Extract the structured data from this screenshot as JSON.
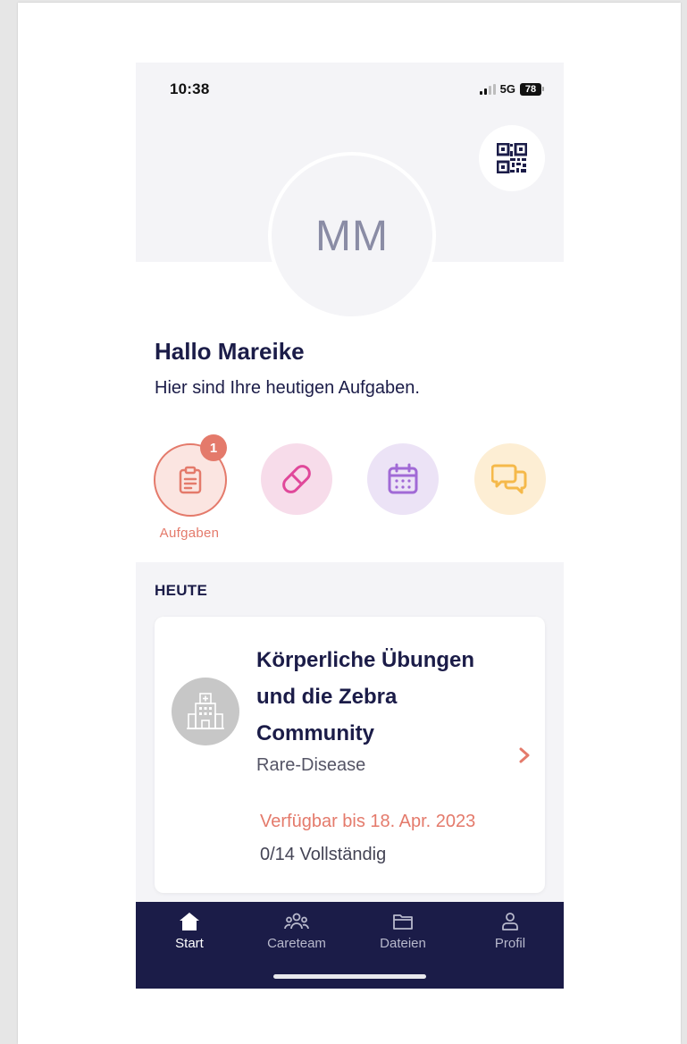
{
  "status_bar": {
    "time": "10:38",
    "network": "5G",
    "battery": "78"
  },
  "header": {
    "qr_icon": "qr-code-icon",
    "avatar_initials": "MM"
  },
  "greeting": {
    "title": "Hallo Mareike",
    "subtitle": "Hier sind Ihre heutigen Aufgaben."
  },
  "quick_actions": [
    {
      "icon": "clipboard-icon",
      "label": "Aufgaben",
      "badge": "1",
      "color": "#e47a6b"
    },
    {
      "icon": "pill-icon",
      "color": "#e0489a"
    },
    {
      "icon": "calendar-icon",
      "color": "#a16ad6"
    },
    {
      "icon": "chat-bubbles-icon",
      "color": "#f5b94a"
    }
  ],
  "today": {
    "title": "HEUTE",
    "card": {
      "icon": "hospital-building-icon",
      "title": "Körperliche Übungen und die Zebra Community",
      "organization": "Rare-Disease",
      "available": "Verfügbar bis 18. Apr. 2023",
      "progress": "0/14 Vollständig"
    }
  },
  "tabbar": {
    "items": [
      {
        "label": "Start",
        "icon": "home-icon",
        "active": true
      },
      {
        "label": "Careteam",
        "icon": "team-icon",
        "active": false
      },
      {
        "label": "Dateien",
        "icon": "folder-icon",
        "active": false
      },
      {
        "label": "Profil",
        "icon": "person-icon",
        "active": false
      }
    ]
  },
  "colors": {
    "primary_dark": "#1b1c48",
    "accent": "#e47a6b",
    "header_bg": "#f4f4f7"
  }
}
